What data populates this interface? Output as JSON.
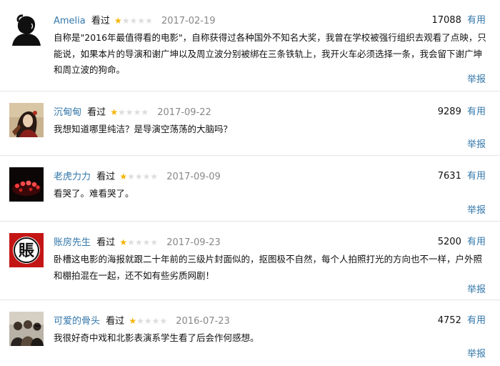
{
  "labels": {
    "watched": "看过",
    "useful": "有用",
    "report": "举报"
  },
  "colors": {
    "link": "#3377aa",
    "star_filled": "#f5b400",
    "star_empty": "#dddddd",
    "date": "#888888",
    "divider": "#e4e4e4"
  },
  "comments": [
    {
      "user": "Amelia",
      "avatar_icon": "silhouette-avatar",
      "rating_stars": 1,
      "rating_max": 5,
      "date": "2017-02-19",
      "votes": "17088",
      "text": "自称是\"2016年最值得看的电影\"，自称获得过各种国外不知名大奖，我曾在学校被强行组织去观看了点映，只能说，如果本片的导演和谢广坤以及周立波分别被绑在三条铁轨上，我开火车必须选择一条，我会留下谢广坤和周立波的狗命。"
    },
    {
      "user": "沉甸甸",
      "avatar_icon": "illustrated-portrait-avatar",
      "rating_stars": 1,
      "rating_max": 5,
      "date": "2017-09-22",
      "votes": "9289",
      "text": "我想知道哪里纯洁？是导演空荡荡的大脑吗？"
    },
    {
      "user": "老虎力力",
      "avatar_icon": "candles-avatar",
      "rating_stars": 1,
      "rating_max": 5,
      "date": "2017-09-09",
      "votes": "7631",
      "text": "看哭了。难看哭了。"
    },
    {
      "user": "账房先生",
      "avatar_icon": "zhang-character-avatar",
      "avatar_glyph": "賬",
      "rating_stars": 1,
      "rating_max": 5,
      "date": "2017-09-23",
      "votes": "5200",
      "text": "卧槽这电影的海报就跟二十年前的三级片封面似的，抠图极不自然，每个人拍照打光的方向也不一样，户外照和棚拍混在一起，还不如有些劣质网剧！"
    },
    {
      "user": "可爱的骨头",
      "avatar_icon": "group-photo-avatar",
      "rating_stars": 1,
      "rating_max": 5,
      "date": "2016-07-23",
      "votes": "4752",
      "text": "我很好奇中戏和北影表演系学生看了后会作何感想。"
    }
  ]
}
